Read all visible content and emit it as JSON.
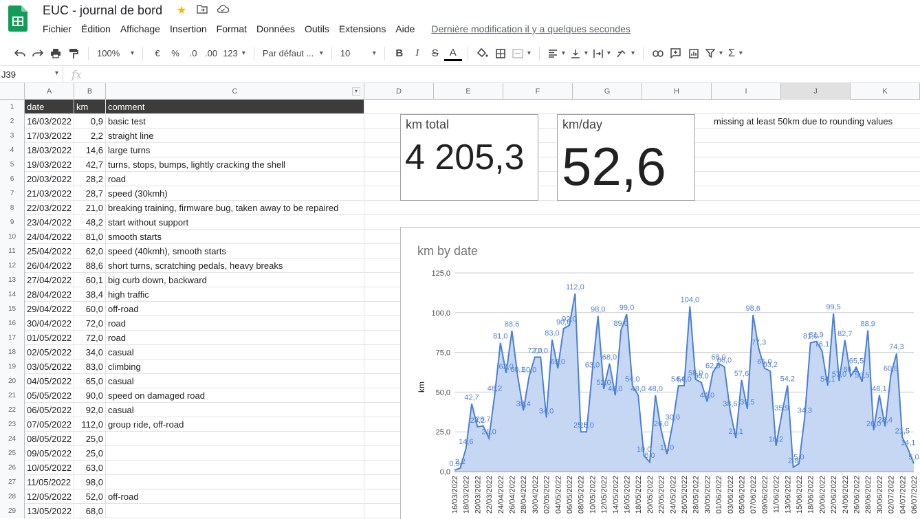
{
  "app": {
    "title": "EUC - journal de bord",
    "menu": [
      "Fichier",
      "Édition",
      "Affichage",
      "Insertion",
      "Format",
      "Données",
      "Outils",
      "Extensions",
      "Aide"
    ],
    "last_modified": "Dernière modification il y a quelques secondes"
  },
  "toolbar": {
    "zoom": "100%",
    "currency": "€",
    "percent": "%",
    "dec_dec": ".0",
    "dec_inc": ".00",
    "numfmt": "123",
    "font": "Par défaut ...",
    "fontsize": "10"
  },
  "formula": {
    "cell_ref": "J39",
    "fx": "fx"
  },
  "columns": [
    "A",
    "B",
    "C",
    "D",
    "E",
    "F",
    "G",
    "H",
    "I",
    "J",
    "K"
  ],
  "sheet_header": {
    "date": "date",
    "km": "km",
    "comment": "comment"
  },
  "rows": [
    {
      "n": "2",
      "date": "16/03/2022",
      "km": "0,9",
      "comment": "basic test"
    },
    {
      "n": "3",
      "date": "17/03/2022",
      "km": "2,2",
      "comment": "straight line"
    },
    {
      "n": "4",
      "date": "18/03/2022",
      "km": "14,6",
      "comment": "large turns"
    },
    {
      "n": "5",
      "date": "19/03/2022",
      "km": "42,7",
      "comment": "turns, stops, bumps, lightly cracking the shell"
    },
    {
      "n": "6",
      "date": "20/03/2022",
      "km": "28,2",
      "comment": "road"
    },
    {
      "n": "7",
      "date": "21/03/2022",
      "km": "28,7",
      "comment": "speed (30kmh)"
    },
    {
      "n": "8",
      "date": "22/03/2022",
      "km": "21,0",
      "comment": "breaking training, firmware bug, taken away to be repaired"
    },
    {
      "n": "9",
      "date": "23/04/2022",
      "km": "48,2",
      "comment": "start without support"
    },
    {
      "n": "10",
      "date": "24/04/2022",
      "km": "81,0",
      "comment": "smooth starts"
    },
    {
      "n": "11",
      "date": "25/04/2022",
      "km": "62,0",
      "comment": "speed (40kmh), smooth starts"
    },
    {
      "n": "12",
      "date": "26/04/2022",
      "km": "88,6",
      "comment": "short turns, scratching pedals, heavy breaks"
    },
    {
      "n": "13",
      "date": "27/04/2022",
      "km": "60,1",
      "comment": "big curb down, backward"
    },
    {
      "n": "14",
      "date": "28/04/2022",
      "km": "38,4",
      "comment": "high traffic"
    },
    {
      "n": "15",
      "date": "29/04/2022",
      "km": "60,0",
      "comment": "off-road"
    },
    {
      "n": "16",
      "date": "30/04/2022",
      "km": "72,0",
      "comment": "road"
    },
    {
      "n": "17",
      "date": "01/05/2022",
      "km": "72,0",
      "comment": "road"
    },
    {
      "n": "18",
      "date": "02/05/2022",
      "km": "34,0",
      "comment": "casual"
    },
    {
      "n": "19",
      "date": "03/05/2022",
      "km": "83,0",
      "comment": "climbing"
    },
    {
      "n": "20",
      "date": "04/05/2022",
      "km": "65,0",
      "comment": "casual"
    },
    {
      "n": "21",
      "date": "05/05/2022",
      "km": "90,0",
      "comment": "speed on damaged road"
    },
    {
      "n": "22",
      "date": "06/05/2022",
      "km": "92,0",
      "comment": "casual"
    },
    {
      "n": "23",
      "date": "07/05/2022",
      "km": "112,0",
      "comment": "group ride, off-road"
    },
    {
      "n": "24",
      "date": "08/05/2022",
      "km": "25,0",
      "comment": ""
    },
    {
      "n": "25",
      "date": "09/05/2022",
      "km": "25,0",
      "comment": ""
    },
    {
      "n": "26",
      "date": "10/05/2022",
      "km": "63,0",
      "comment": ""
    },
    {
      "n": "27",
      "date": "11/05/2022",
      "km": "98,0",
      "comment": ""
    },
    {
      "n": "28",
      "date": "12/05/2022",
      "km": "52,0",
      "comment": "off-road"
    },
    {
      "n": "29",
      "date": "13/05/2022",
      "km": "68,0",
      "comment": ""
    }
  ],
  "scorecards": {
    "total": {
      "label": "km total",
      "value": "4 205,3"
    },
    "per_day": {
      "label": "km/day",
      "value": "52,6"
    }
  },
  "note": "missing at least 50km due to rounding values",
  "colors": {
    "accent": "#4a7fd6",
    "fill": "#c6d7f4",
    "sheets_green": "#0f9d58"
  },
  "chart_data": {
    "type": "area",
    "title": "km by date",
    "ylabel": "km",
    "xlabel": "",
    "ylim": [
      0,
      125
    ],
    "yticks": [
      "0,0",
      "25,0",
      "50,0",
      "75,0",
      "100,0",
      "125,0"
    ],
    "xtick_labels": [
      "16/03/2022",
      "18/03/2022",
      "20/03/2022",
      "22/03/2022",
      "24/04/2022",
      "26/04/2022",
      "28/04/2022",
      "30/04/2022",
      "02/05/2022",
      "04/05/2022",
      "06/05/2022",
      "08/05/2022",
      "10/05/2022",
      "12/05/2022",
      "14/05/2022",
      "16/05/2022",
      "18/05/2022",
      "20/05/2022",
      "22/05/2022",
      "24/05/2022",
      "26/05/2022",
      "28/05/2022",
      "30/05/2022",
      "01/06/2022",
      "03/06/2022",
      "05/06/2022",
      "07/06/2022",
      "09/06/2022",
      "11/06/2022",
      "13/06/2022",
      "15/06/2022",
      "18/06/2022",
      "20/06/2022",
      "22/06/2022",
      "24/06/2022",
      "26/06/2022",
      "28/06/2022",
      "30/06/2022",
      "02/07/2022",
      "04/07/2022",
      "06/07/2022"
    ],
    "values": [
      0.9,
      2.2,
      14.6,
      42.7,
      28.2,
      28.7,
      21.0,
      48.2,
      81.0,
      62.0,
      88.6,
      60.1,
      38.4,
      60.0,
      72.0,
      72.0,
      34.0,
      83.0,
      65.0,
      90.0,
      92.0,
      112.0,
      25.0,
      25.0,
      63.0,
      98.0,
      52.0,
      68.0,
      48.0,
      89.0,
      99.0,
      54.0,
      48.0,
      10.0,
      6.0,
      48.0,
      26.0,
      11.0,
      30.0,
      54.0,
      54.0,
      104.0,
      58.0,
      56.0,
      44.0,
      62.5,
      68.0,
      66.0,
      38.6,
      21.1,
      57.6,
      39.5,
      98.6,
      77.3,
      65.0,
      63.2,
      16.2,
      35.9,
      54.2,
      2.8,
      5.0,
      34.3,
      81.0,
      81.9,
      76.1,
      54.1,
      99.5,
      57.0,
      82.7,
      60.1,
      65.5,
      56.5,
      88.9,
      26.0,
      48.1,
      28.4,
      60.8,
      74.3,
      21.5,
      14.1,
      5.0
    ],
    "value_labels": [
      "0,9",
      "2,2",
      "14,6",
      "42,7",
      "28,2",
      "28,7",
      "21,0",
      "48,2",
      "81,0",
      "62,0",
      "88,6",
      "60,1",
      "38,4",
      "60,0",
      "72,0",
      "72,0",
      "34,0",
      "83,0",
      "65,0",
      "90,0",
      "92,0",
      "112,0",
      "25,0",
      "25,0",
      "63,0",
      "98,0",
      "52,0",
      "68,0",
      "48,0",
      "89,0",
      "99,0",
      "54,0",
      "48,0",
      "10,0",
      "6,0",
      "48,0",
      "26,0",
      "11,0",
      "30,0",
      "54,0",
      "54,0",
      "104,0",
      "58,0",
      "56,0",
      "44,0",
      "62,5",
      "68,0",
      "66,0",
      "38,6",
      "21,1",
      "57,6",
      "39,5",
      "98,6",
      "77,3",
      "65,0",
      "63,2",
      "16,2",
      "35,9",
      "54,2",
      "2,8",
      "5,0",
      "34,3",
      "81,0",
      "81,9",
      "76,1",
      "54,1",
      "99,5",
      "57,0",
      "82,7",
      "60,1",
      "65,5",
      "56,5",
      "88,9",
      "26,0",
      "48,1",
      "28,4",
      "60,8",
      "74,3",
      "21,5",
      "14,1",
      "5,0"
    ],
    "grid": true
  }
}
